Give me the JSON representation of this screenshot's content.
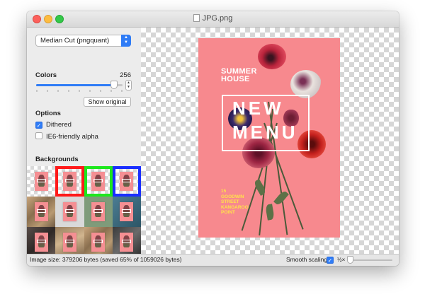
{
  "window": {
    "title": "JPG.png"
  },
  "sidebar": {
    "algorithm_select": "Median Cut (pngquant)",
    "colors_label": "Colors",
    "colors_value": "256",
    "colors_slider_fraction": 0.9,
    "show_original_label": "Show original",
    "options_label": "Options",
    "dithered_label": "Dithered",
    "dithered_checked": true,
    "ie6_label": "IE6-friendly alpha",
    "ie6_checked": false,
    "backgrounds_label": "Backgrounds"
  },
  "poster": {
    "line1": "SUMMER",
    "line2": "HOUSE",
    "big1": "NEW",
    "big2": "MENU",
    "address": [
      "15",
      "GOODWIN",
      "STREET",
      "KANGAROO",
      "POINT"
    ]
  },
  "status": {
    "text": "Image size: 379206 bytes (saved 65% of 1059026 bytes)",
    "smooth_scaling_label": "Smooth scaling",
    "smooth_scaling_checked": true,
    "zoom_label": "½×"
  },
  "colors": {
    "accent": "#2f7cf6",
    "poster_bg": "#f7898e",
    "poster_yellow": "#ffe24a",
    "swatch_red": "#ff1a1a",
    "swatch_green": "#1ee81e",
    "swatch_blue": "#1a2fff"
  }
}
